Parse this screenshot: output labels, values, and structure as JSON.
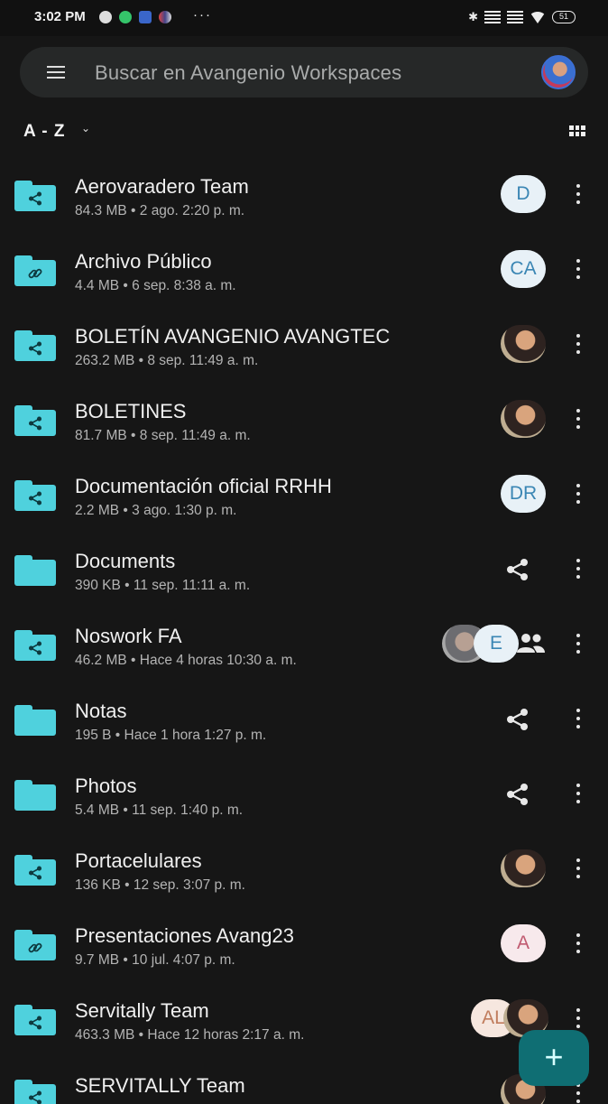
{
  "status_bar": {
    "time": "3:02 PM",
    "battery": "51"
  },
  "search": {
    "placeholder": "Buscar en Avangenio Workspaces"
  },
  "sort": {
    "label": "A - Z"
  },
  "colors": {
    "folder": "#4fd1dd",
    "fab": "#0f6e73",
    "background": "#161616"
  },
  "items": [
    {
      "name": "Aerovaradero Team",
      "meta": "84.3 MB • 2 ago. 2:20 p. m.",
      "folder_icon": "shared-folder-icon",
      "avatar": "D"
    },
    {
      "name": "Archivo Público",
      "meta": "4.4 MB • 6 sep. 8:38 a. m.",
      "folder_icon": "link-folder-icon",
      "avatar": "CA"
    },
    {
      "name": "BOLETÍN AVANGENIO AVANGTEC",
      "meta": "263.2 MB • 8 sep. 11:49 a. m.",
      "folder_icon": "shared-folder-icon",
      "avatar": "photo"
    },
    {
      "name": "BOLETINES",
      "meta": "81.7 MB • 8 sep. 11:49 a. m.",
      "folder_icon": "shared-folder-icon",
      "avatar": "photo"
    },
    {
      "name": "Documentación oficial RRHH",
      "meta": "2.2 MB • 3 ago. 1:30 p. m.",
      "folder_icon": "shared-folder-icon",
      "avatar": "DR"
    },
    {
      "name": "Documents",
      "meta": "390 KB • 11 sep. 11:11 a. m.",
      "folder_icon": "folder-icon",
      "avatar": "share"
    },
    {
      "name": "Noswork FA",
      "meta": "46.2 MB • Hace 4 horas 10:30 a. m.",
      "folder_icon": "shared-folder-icon",
      "avatar": "E"
    },
    {
      "name": "Notas",
      "meta": "195 B • Hace 1 hora 1:27 p. m.",
      "folder_icon": "folder-icon",
      "avatar": "share"
    },
    {
      "name": "Photos",
      "meta": "5.4 MB • 11 sep. 1:40 p. m.",
      "folder_icon": "folder-icon",
      "avatar": "share"
    },
    {
      "name": "Portacelulares",
      "meta": "136 KB • 12 sep. 3:07 p. m.",
      "folder_icon": "shared-folder-icon",
      "avatar": "photo"
    },
    {
      "name": "Presentaciones Avang23",
      "meta": "9.7 MB • 10 jul. 4:07 p. m.",
      "folder_icon": "link-folder-icon",
      "avatar": "A"
    },
    {
      "name": "Servitally Team",
      "meta": "463.3 MB • Hace 12 horas 2:17 a. m.",
      "folder_icon": "shared-folder-icon",
      "avatar": "AL"
    },
    {
      "name": "SERVITALLY Team",
      "meta": "",
      "folder_icon": "shared-folder-icon",
      "avatar": "photo"
    }
  ],
  "fab": {
    "label": "+"
  }
}
